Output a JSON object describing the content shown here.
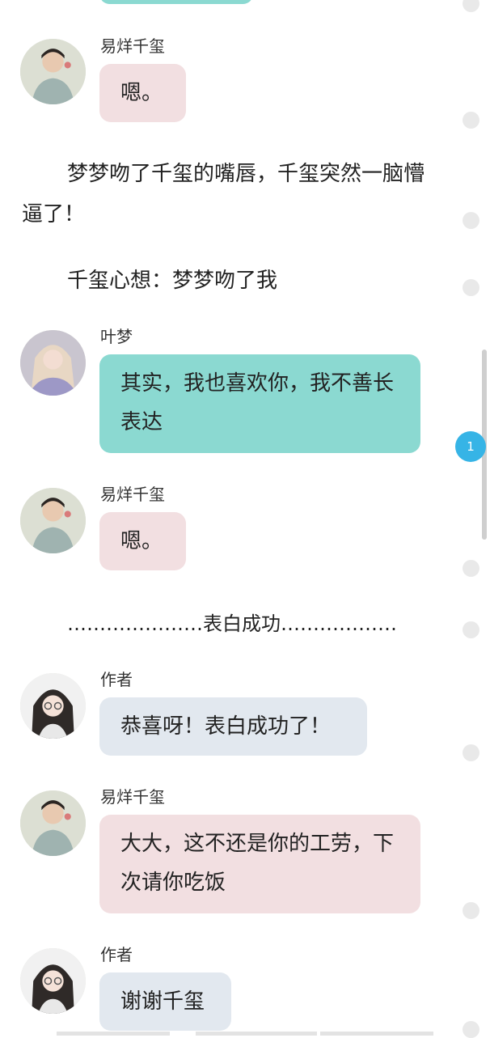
{
  "messages": {
    "m1": {
      "name": "易烊千玺",
      "text": "嗯。"
    },
    "m2": {
      "name": "叶梦",
      "text": "其实，我也喜欢你，我不善长表达"
    },
    "m3": {
      "name": "易烊千玺",
      "text": "嗯。"
    },
    "m4": {
      "name": "作者",
      "text": "恭喜呀！表白成功了！"
    },
    "m5": {
      "name": "易烊千玺",
      "text": "大大，这不还是你的工劳，下次请你吃饭"
    },
    "m6": {
      "name": "作者",
      "text": "谢谢千玺"
    }
  },
  "narration": {
    "n1": "梦梦吻了千玺的嘴唇，千玺突然一脑懵逼了！",
    "n2": "千玺心想：梦梦吻了我",
    "n3": "…………………表白成功………………"
  },
  "badge": {
    "count": "1"
  },
  "colors": {
    "pink": "#f2dfe1",
    "teal": "#8bd9d1",
    "grey": "#e2e8ef",
    "badge": "#36b4e6"
  },
  "icons": {
    "avatar_qianxi": "boy-avatar-icon",
    "avatar_yemeng": "girl-avatar-icon",
    "avatar_author": "author-avatar-icon"
  }
}
